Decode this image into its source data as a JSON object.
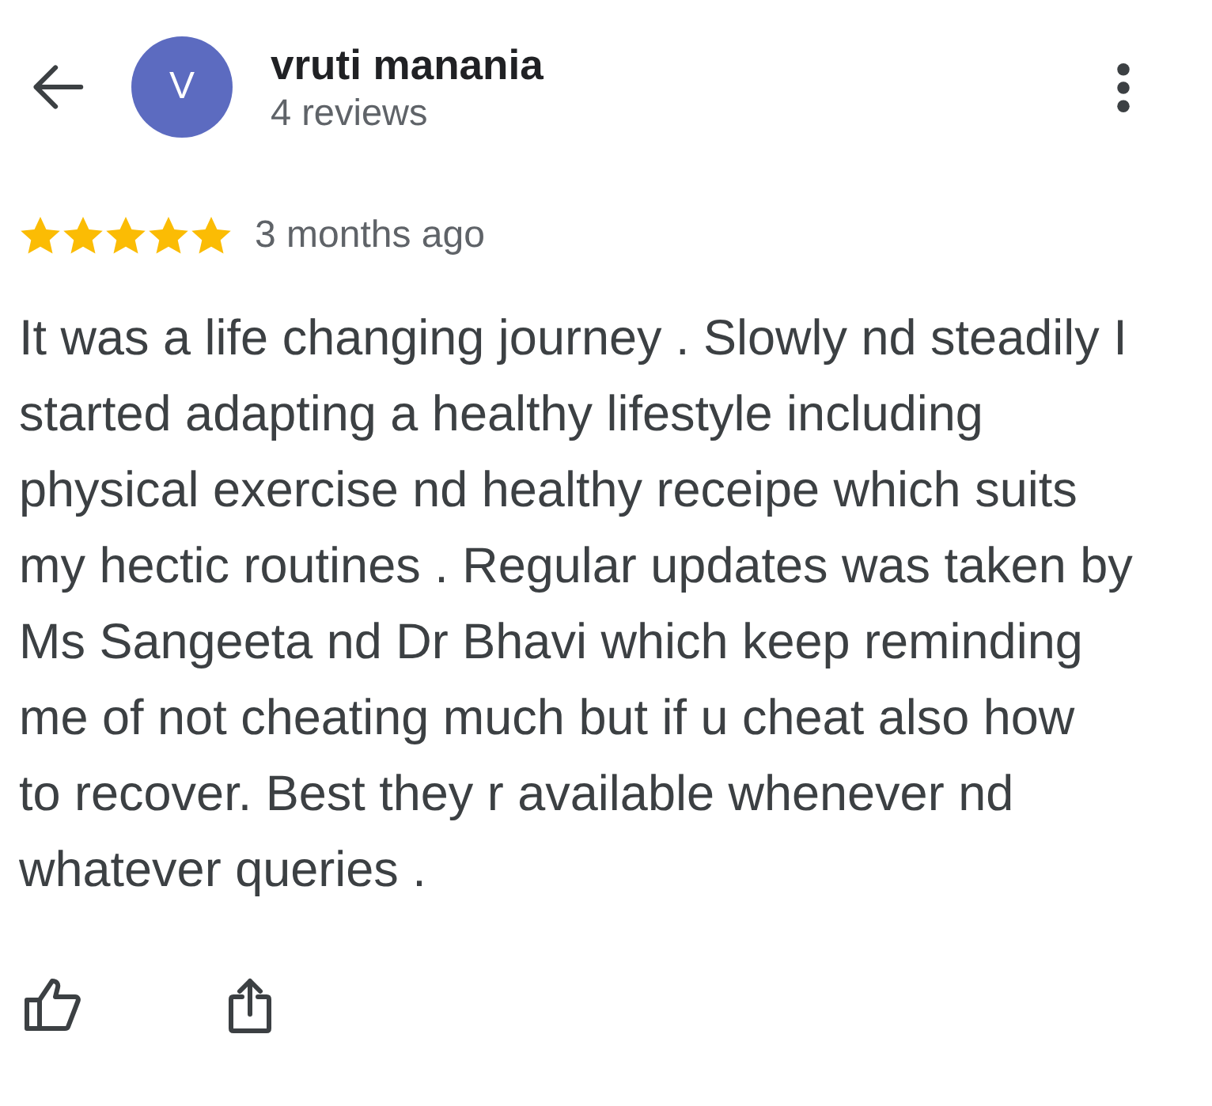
{
  "header": {
    "avatar_letter": "V",
    "name": "vruti manania",
    "review_count": "4 reviews"
  },
  "review": {
    "stars": 5,
    "time": "3 months ago",
    "text": "It was a life changing journey . Slowly nd steadily I started adapting a healthy lifestyle including physical exercise nd healthy receipe which suits my hectic routines . Regular updates was taken by Ms Sangeeta nd Dr Bhavi which keep reminding me of not cheating much but if u cheat also how to recover. Best they r available whenever nd whatever queries ."
  }
}
